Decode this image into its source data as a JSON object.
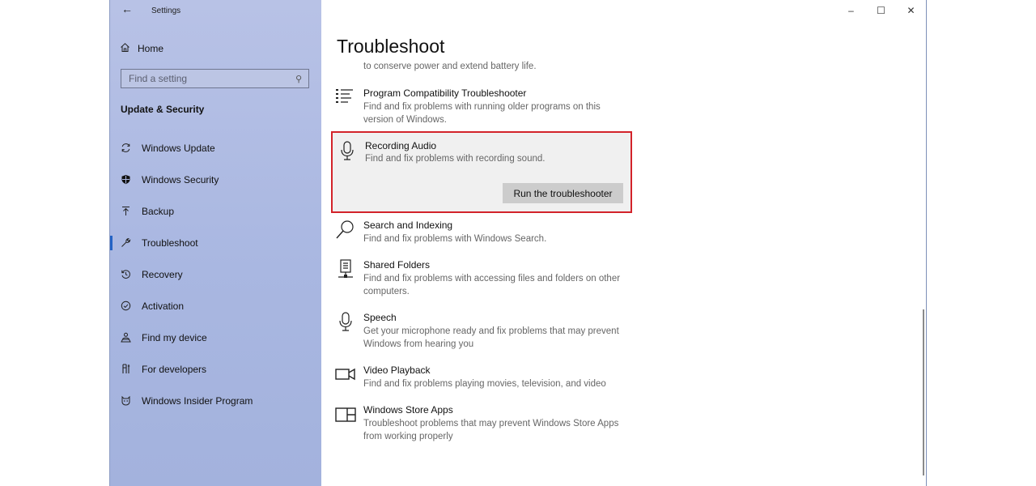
{
  "window": {
    "title": "Settings"
  },
  "window_controls": {
    "minimize": "–",
    "maximize": "☐",
    "close": "✕"
  },
  "sidebar": {
    "home_label": "Home",
    "search_placeholder": "Find a setting",
    "section_title": "Update & Security",
    "items": [
      {
        "label": "Windows Update",
        "icon": "refresh-icon"
      },
      {
        "label": "Windows Security",
        "icon": "shield-icon"
      },
      {
        "label": "Backup",
        "icon": "upload-arrow-icon"
      },
      {
        "label": "Troubleshoot",
        "icon": "wrench-icon",
        "active": true
      },
      {
        "label": "Recovery",
        "icon": "history-icon"
      },
      {
        "label": "Activation",
        "icon": "check-circle-icon"
      },
      {
        "label": "Find my device",
        "icon": "person-location-icon"
      },
      {
        "label": "For developers",
        "icon": "developer-tools-icon"
      },
      {
        "label": "Windows Insider Program",
        "icon": "insider-cat-icon"
      }
    ]
  },
  "main": {
    "title": "Troubleshoot",
    "cut_text": "to conserve power and extend battery life.",
    "troubleshooters": [
      {
        "name": "Program Compatibility Troubleshooter",
        "desc": "Find and fix problems with running older programs on this version of Windows.",
        "icon": "list-icon"
      },
      {
        "name": "Recording Audio",
        "desc": "Find and fix problems with recording sound.",
        "icon": "microphone-icon",
        "selected": true
      },
      {
        "name": "Search and Indexing",
        "desc": "Find and fix problems with Windows Search.",
        "icon": "search-icon"
      },
      {
        "name": "Shared Folders",
        "desc": "Find and fix problems with accessing files and folders on other computers.",
        "icon": "network-drive-icon"
      },
      {
        "name": "Speech",
        "desc": "Get your microphone ready and fix problems that may prevent Windows from hearing you",
        "icon": "microphone-icon"
      },
      {
        "name": "Video Playback",
        "desc": "Find and fix problems playing movies, television, and video",
        "icon": "video-camera-icon"
      },
      {
        "name": "Windows Store Apps",
        "desc": "Troubleshoot problems that may prevent Windows Store Apps from working properly",
        "icon": "store-app-icon"
      }
    ],
    "run_button": "Run the troubleshooter"
  },
  "colors": {
    "accent": "#2463c5",
    "highlight_border": "#d3232a",
    "sidebar_bg": "#aab6e0"
  }
}
